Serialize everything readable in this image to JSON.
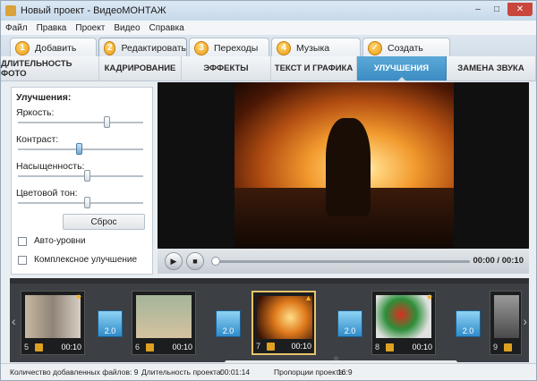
{
  "window": {
    "title": "Новый проект - ВидеоМОНТАЖ",
    "minimize": "–",
    "maximize": "□",
    "close": "✕"
  },
  "menu": [
    "Файл",
    "Правка",
    "Проект",
    "Видео",
    "Справка"
  ],
  "steps": [
    {
      "num": "1",
      "label": "Добавить"
    },
    {
      "num": "2",
      "label": "Редактировать"
    },
    {
      "num": "3",
      "label": "Переходы"
    },
    {
      "num": "4",
      "label": "Музыка"
    },
    {
      "num": "✓",
      "label": "Создать"
    }
  ],
  "tabs": [
    "ДЛИТЕЛЬНОСТЬ ФОТО",
    "КАДРИРОВАНИЕ",
    "ЭФФЕКТЫ",
    "ТЕКСТ И ГРАФИКА",
    "УЛУЧШЕНИЯ",
    "ЗАМЕНА ЗВУКА"
  ],
  "enhance": {
    "title": "Улучшения:",
    "brightness_label": "Яркость:",
    "contrast_label": "Контраст:",
    "saturation_label": "Насыщенность:",
    "hue_label": "Цветовой тон:",
    "reset": "Сброс",
    "auto_levels": "Авто-уровни",
    "complex": "Комплексное улучшение"
  },
  "player": {
    "time": "00:00 / 00:10",
    "play_icon": "▶",
    "stop_icon": "■"
  },
  "timeline": {
    "clips": [
      {
        "num": "5",
        "dur": "00:10"
      },
      {
        "num": "6",
        "dur": "00:10"
      },
      {
        "num": "7",
        "dur": "00:10"
      },
      {
        "num": "8",
        "dur": "00:10"
      },
      {
        "num": "9",
        "dur": ""
      }
    ],
    "transition": "2.0",
    "scroll_label": "III"
  },
  "status": {
    "files": "Количество добавленных файлов: 9",
    "duration": "Длительность проекта:",
    "duration_val": "00:01:14",
    "ratio": "Пропорции проекта:",
    "ratio_val": "16:9"
  },
  "colors": {
    "accent": "#4a9bd0",
    "step_badge": "#f0a52a",
    "selected_clip": "#e6c46a"
  }
}
